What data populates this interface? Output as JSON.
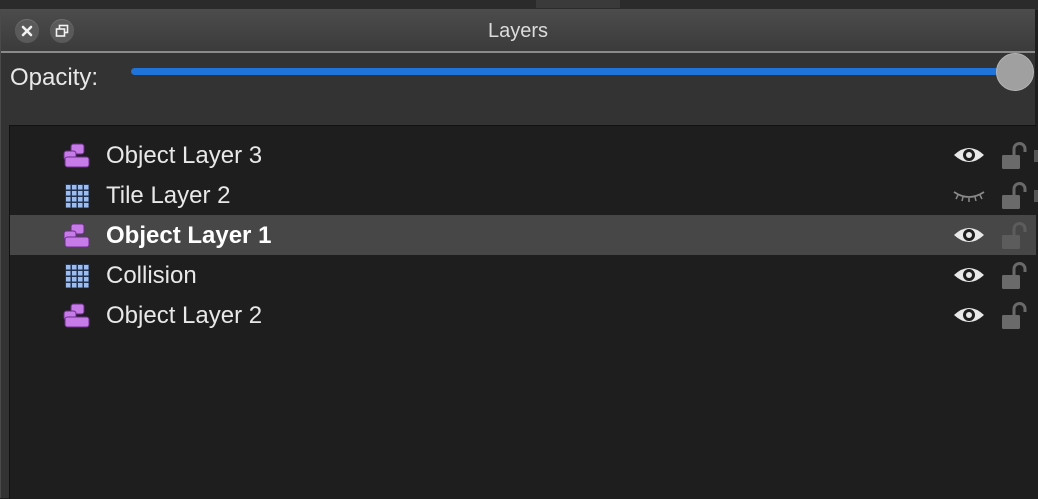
{
  "panel": {
    "title": "Layers"
  },
  "opacity": {
    "label": "Opacity:",
    "value": 1.0
  },
  "layers": [
    {
      "name": "Object Layer 3",
      "type": "object",
      "visible": true,
      "locked": false,
      "selected": false
    },
    {
      "name": "Tile Layer 2",
      "type": "tile",
      "visible": false,
      "locked": false,
      "selected": false
    },
    {
      "name": "Object Layer 1",
      "type": "object",
      "visible": true,
      "locked": false,
      "selected": true
    },
    {
      "name": "Collision",
      "type": "tile",
      "visible": true,
      "locked": false,
      "selected": false
    },
    {
      "name": "Object Layer 2",
      "type": "object",
      "visible": true,
      "locked": false,
      "selected": false
    }
  ],
  "icons": {
    "close": "close-icon",
    "float": "float-window-icon",
    "object_layer": "object-layer-icon",
    "tile_layer": "tile-layer-icon",
    "eye_open": "eye-icon",
    "eye_closed": "eye-closed-icon",
    "lock": "unlock-icon"
  },
  "colors": {
    "accent": "#1f73d9",
    "object_icon": "#c77be8",
    "tile_icon": "#9dbdf0"
  }
}
